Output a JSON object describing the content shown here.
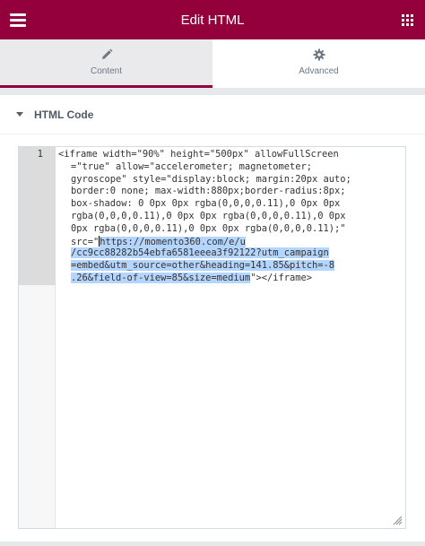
{
  "header": {
    "title": "Edit HTML",
    "menu_icon": "hamburger-icon",
    "apps_icon": "grid-icon",
    "color": "#93003c"
  },
  "tabs": [
    {
      "label": "Content",
      "icon": "pencil-icon",
      "active": true
    },
    {
      "label": "Advanced",
      "icon": "gear-icon",
      "active": false
    }
  ],
  "section": {
    "title": "HTML Code"
  },
  "editor": {
    "line_number": "1",
    "lines": [
      "<iframe width=\"90%\" height=\"500px\" allowFullScreen",
      "=\"true\" allow=\"accelerometer; magnetometer;",
      "gyroscope\" style=\"display:block; margin:20px auto;",
      "border:0 none; max-width:880px;border-radius:8px;",
      "box-shadow: 0 0px 0px rgba(0,0,0,0.11),0 0px 0px",
      "rgba(0,0,0,0.11),0 0px 0px rgba(0,0,0,0.11),0 0px",
      "0px rgba(0,0,0,0.11),0 0px 0px rgba(0,0,0,0.11);\""
    ],
    "src_prefix": "src=\"",
    "selected_lines": [
      "https://momento360.com/e/u",
      "/cc9cc88282b54ebfa6581eeea3f92122?utm_campaign",
      "=embed&utm_source=other&heading=141.85&pitch=-8",
      ".26&field-of-view=85&size=medium"
    ],
    "closing": "\"></iframe>"
  }
}
